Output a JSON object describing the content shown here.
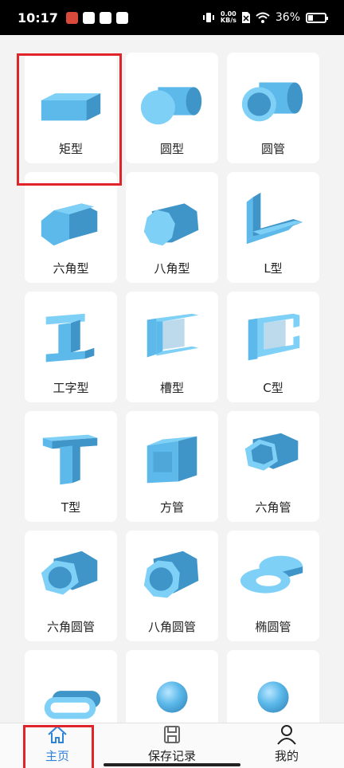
{
  "status": {
    "time": "10:17",
    "speed_value": "0.00",
    "speed_unit": "KB/s",
    "battery": "36%",
    "battery_level": 0.36
  },
  "colors": {
    "accent": "#2f83d8",
    "shape_top": "#7fd0f7",
    "shape_front": "#5cb9ea",
    "shape_side": "#3f94c8",
    "highlight": "#e0252a"
  },
  "items": [
    {
      "label": "矩型",
      "icon": "rectangle-bar-icon"
    },
    {
      "label": "圆型",
      "icon": "round-bar-icon"
    },
    {
      "label": "圆管",
      "icon": "round-tube-icon"
    },
    {
      "label": "六角型",
      "icon": "hexagon-bar-icon"
    },
    {
      "label": "八角型",
      "icon": "octagon-bar-icon"
    },
    {
      "label": "L型",
      "icon": "l-profile-icon"
    },
    {
      "label": "工字型",
      "icon": "i-beam-icon"
    },
    {
      "label": "槽型",
      "icon": "channel-icon"
    },
    {
      "label": "C型",
      "icon": "c-profile-icon"
    },
    {
      "label": "T型",
      "icon": "t-profile-icon"
    },
    {
      "label": "方管",
      "icon": "square-tube-icon"
    },
    {
      "label": "六角管",
      "icon": "hexagon-tube-icon"
    },
    {
      "label": "六角圆管",
      "icon": "hexagon-round-tube-icon"
    },
    {
      "label": "八角圆管",
      "icon": "octagon-round-tube-icon"
    },
    {
      "label": "椭圆管",
      "icon": "oval-tube-icon"
    },
    {
      "label": "",
      "icon": "obround-tube-icon"
    },
    {
      "label": "",
      "icon": "sphere-icon"
    },
    {
      "label": "",
      "icon": "sphere-icon"
    }
  ],
  "nav": {
    "home": "主页",
    "records": "保存记录",
    "mine": "我的"
  }
}
